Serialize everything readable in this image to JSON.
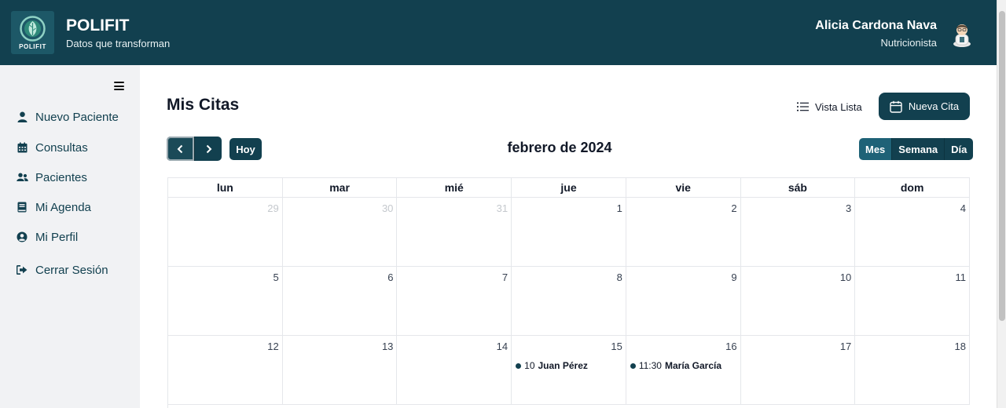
{
  "header": {
    "logo_text": "POLIFIT",
    "brand": "POLIFIT",
    "tagline": "Datos que transforman",
    "user_name": "Alicia Cardona Nava",
    "user_role": "Nutricionista"
  },
  "sidebar": {
    "items": [
      {
        "label": "Nuevo Paciente",
        "icon": "user-icon"
      },
      {
        "label": "Consultas",
        "icon": "calendar-icon"
      },
      {
        "label": "Pacientes",
        "icon": "users-icon"
      },
      {
        "label": "Mi Agenda",
        "icon": "book-icon"
      },
      {
        "label": "Mi Perfil",
        "icon": "user-circle-icon"
      },
      {
        "label": "Cerrar Sesión",
        "icon": "sign-out-icon"
      }
    ]
  },
  "page": {
    "title": "Mis Citas",
    "list_view_label": "Vista Lista",
    "new_appointment_label": "Nueva Cita"
  },
  "calendar": {
    "today_label": "Hoy",
    "title": "febrero de 2024",
    "views": [
      "Mes",
      "Semana",
      "Día"
    ],
    "active_view": "Mes",
    "weekdays": [
      "lun",
      "mar",
      "mié",
      "jue",
      "vie",
      "sáb",
      "dom"
    ],
    "weeks": [
      [
        {
          "d": "29",
          "other": true
        },
        {
          "d": "30",
          "other": true
        },
        {
          "d": "31",
          "other": true
        },
        {
          "d": "1"
        },
        {
          "d": "2"
        },
        {
          "d": "3"
        },
        {
          "d": "4"
        }
      ],
      [
        {
          "d": "5"
        },
        {
          "d": "6"
        },
        {
          "d": "7"
        },
        {
          "d": "8"
        },
        {
          "d": "9"
        },
        {
          "d": "10"
        },
        {
          "d": "11"
        }
      ],
      [
        {
          "d": "12"
        },
        {
          "d": "13"
        },
        {
          "d": "14"
        },
        {
          "d": "15",
          "event": {
            "time": "10",
            "name": "Juan Pérez"
          }
        },
        {
          "d": "16",
          "event": {
            "time": "11:30",
            "name": "María García"
          }
        },
        {
          "d": "17"
        },
        {
          "d": "18"
        }
      ]
    ]
  },
  "colors": {
    "primary": "#12404f",
    "active_view": "#1f6277",
    "sidebar_bg": "#f1f2f4"
  }
}
